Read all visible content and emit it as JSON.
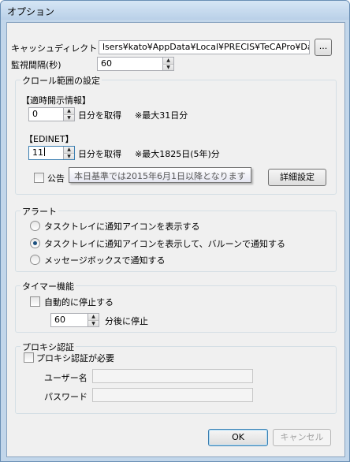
{
  "window": {
    "title": "オプション"
  },
  "cache_dir": {
    "label": "キャッシュディレクトリ",
    "value": "lsers¥kato¥AppData¥Local¥PRECIS¥TeCAPro¥Data",
    "browse_label": "..."
  },
  "interval": {
    "label": "監視間隔(秒)",
    "value": "60"
  },
  "crawl": {
    "title": "クロール範囲の設定",
    "timely": {
      "heading": "【適時開示情報】",
      "value": "0",
      "unit": "日分を取得",
      "note": "※最大31日分"
    },
    "edinet": {
      "heading": "【EDINET】",
      "value": "11",
      "unit": "日分を取得",
      "note": "※最大1825日(5年)分"
    },
    "koukoku_label": "公告",
    "tooltip": "本日基準では2015年6月1日以降となります",
    "detail_button": "詳細設定"
  },
  "alert": {
    "title": "アラート",
    "options": [
      {
        "label": "タスクトレイに通知アイコンを表示する",
        "checked": false
      },
      {
        "label": "タスクトレイに通知アイコンを表示して、バルーンで通知する",
        "checked": true
      },
      {
        "label": "メッセージボックスで通知する",
        "checked": false
      }
    ]
  },
  "timer": {
    "title": "タイマー機能",
    "auto_stop_label": "自動的に停止する",
    "minutes_value": "60",
    "minutes_suffix": "分後に停止"
  },
  "proxy": {
    "title": "プロキシ認証",
    "required_label": "プロキシ認証が必要",
    "user_label": "ユーザー名",
    "user_value": "",
    "password_label": "パスワード",
    "password_value": ""
  },
  "footer": {
    "ok": "OK",
    "cancel": "キャンセル"
  }
}
